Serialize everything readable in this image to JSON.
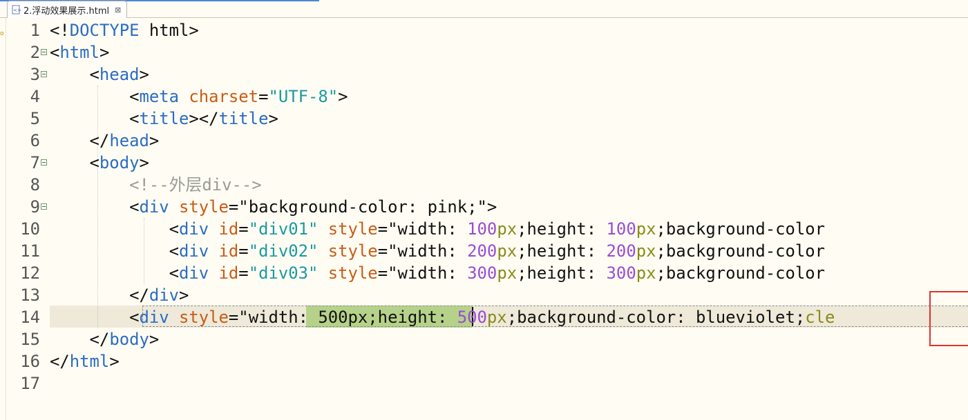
{
  "tab": {
    "title": "2.浮动效果展示.html",
    "close_glyph": "⊠",
    "icon": "html-file-icon"
  },
  "left_marker": "o",
  "colors": {
    "tag": "#2a6cc4",
    "attr": "#c85c16",
    "value": "#1a9aa0",
    "number": "#9a4bd6",
    "unit": "#8a8a1a",
    "comment": "#9a9a9a",
    "selection": "#b6d28a",
    "highlight_box": "#e0312b"
  },
  "editor": {
    "current_line": 14,
    "lines": [
      {
        "n": "1",
        "fold": false,
        "tokens": [
          {
            "t": "<!",
            "c": "br"
          },
          {
            "t": "DOCTYPE",
            "c": "tag"
          },
          {
            "t": " html",
            "c": "txt"
          },
          {
            "t": ">",
            "c": "br"
          }
        ]
      },
      {
        "n": "2",
        "fold": true,
        "tokens": [
          {
            "t": "<",
            "c": "br"
          },
          {
            "t": "html",
            "c": "tag"
          },
          {
            "t": ">",
            "c": "br"
          }
        ]
      },
      {
        "n": "3",
        "fold": true,
        "tokens": [
          {
            "t": "    <",
            "c": "br"
          },
          {
            "t": "head",
            "c": "tag"
          },
          {
            "t": ">",
            "c": "br"
          }
        ]
      },
      {
        "n": "4",
        "fold": false,
        "tokens": [
          {
            "t": "        <",
            "c": "br"
          },
          {
            "t": "meta",
            "c": "tag"
          },
          {
            "t": " charset",
            "c": "attr"
          },
          {
            "t": "=",
            "c": "br"
          },
          {
            "t": "\"UTF-8\"",
            "c": "val"
          },
          {
            "t": ">",
            "c": "br"
          }
        ]
      },
      {
        "n": "5",
        "fold": false,
        "tokens": [
          {
            "t": "        <",
            "c": "br"
          },
          {
            "t": "title",
            "c": "tag"
          },
          {
            "t": "></",
            "c": "br"
          },
          {
            "t": "title",
            "c": "tag"
          },
          {
            "t": ">",
            "c": "br"
          }
        ]
      },
      {
        "n": "6",
        "fold": false,
        "tokens": [
          {
            "t": "    </",
            "c": "br"
          },
          {
            "t": "head",
            "c": "tag"
          },
          {
            "t": ">",
            "c": "br"
          }
        ]
      },
      {
        "n": "7",
        "fold": true,
        "tokens": [
          {
            "t": "    <",
            "c": "br"
          },
          {
            "t": "body",
            "c": "tag"
          },
          {
            "t": ">",
            "c": "br"
          }
        ]
      },
      {
        "n": "8",
        "fold": false,
        "tokens": [
          {
            "t": "        <!--外层div-->",
            "c": "com"
          }
        ]
      },
      {
        "n": "9",
        "fold": true,
        "tokens": [
          {
            "t": "        <",
            "c": "br"
          },
          {
            "t": "div",
            "c": "tag"
          },
          {
            "t": " style",
            "c": "attr"
          },
          {
            "t": "=\"",
            "c": "br"
          },
          {
            "t": "background-color: pink;",
            "c": "txt"
          },
          {
            "t": "\">",
            "c": "br"
          }
        ]
      },
      {
        "n": "10",
        "fold": false,
        "tokens": [
          {
            "t": "            <",
            "c": "br"
          },
          {
            "t": "div",
            "c": "tag"
          },
          {
            "t": " id",
            "c": "attr"
          },
          {
            "t": "=",
            "c": "br"
          },
          {
            "t": "\"div01\"",
            "c": "val"
          },
          {
            "t": " style",
            "c": "attr"
          },
          {
            "t": "=\"",
            "c": "br"
          },
          {
            "t": "width: ",
            "c": "txt"
          },
          {
            "t": "100",
            "c": "num"
          },
          {
            "t": "px",
            "c": "px"
          },
          {
            "t": ";height: ",
            "c": "txt"
          },
          {
            "t": "100",
            "c": "num"
          },
          {
            "t": "px",
            "c": "px"
          },
          {
            "t": ";background-color",
            "c": "txt"
          }
        ]
      },
      {
        "n": "11",
        "fold": false,
        "tokens": [
          {
            "t": "            <",
            "c": "br"
          },
          {
            "t": "div",
            "c": "tag"
          },
          {
            "t": " id",
            "c": "attr"
          },
          {
            "t": "=",
            "c": "br"
          },
          {
            "t": "\"div02\"",
            "c": "val"
          },
          {
            "t": " style",
            "c": "attr"
          },
          {
            "t": "=\"",
            "c": "br"
          },
          {
            "t": "width: ",
            "c": "txt"
          },
          {
            "t": "200",
            "c": "num"
          },
          {
            "t": "px",
            "c": "px"
          },
          {
            "t": ";height: ",
            "c": "txt"
          },
          {
            "t": "200",
            "c": "num"
          },
          {
            "t": "px",
            "c": "px"
          },
          {
            "t": ";background-color",
            "c": "txt"
          }
        ]
      },
      {
        "n": "12",
        "fold": false,
        "tokens": [
          {
            "t": "            <",
            "c": "br"
          },
          {
            "t": "div",
            "c": "tag"
          },
          {
            "t": " id",
            "c": "attr"
          },
          {
            "t": "=",
            "c": "br"
          },
          {
            "t": "\"div03\"",
            "c": "val"
          },
          {
            "t": " style",
            "c": "attr"
          },
          {
            "t": "=\"",
            "c": "br"
          },
          {
            "t": "width: ",
            "c": "txt"
          },
          {
            "t": "300",
            "c": "num"
          },
          {
            "t": "px",
            "c": "px"
          },
          {
            "t": ";height: ",
            "c": "txt"
          },
          {
            "t": "300",
            "c": "num"
          },
          {
            "t": "px",
            "c": "px"
          },
          {
            "t": ";background-color",
            "c": "txt"
          }
        ]
      },
      {
        "n": "13",
        "fold": false,
        "tokens": [
          {
            "t": "        </",
            "c": "br"
          },
          {
            "t": "div",
            "c": "tag"
          },
          {
            "t": ">",
            "c": "br"
          }
        ]
      },
      {
        "n": "14",
        "fold": false,
        "tokens": [
          {
            "t": "        <",
            "c": "br"
          },
          {
            "t": "div",
            "c": "tag"
          },
          {
            "t": " style",
            "c": "attr"
          },
          {
            "t": "=\"",
            "c": "br"
          },
          {
            "t": "width: 500px;height: ",
            "c": "txt"
          },
          {
            "t": "500",
            "c": "num"
          },
          {
            "t": "px",
            "c": "px"
          },
          {
            "t": ";background-color: blueviolet;",
            "c": "txt"
          },
          {
            "t": "cle",
            "c": "px"
          }
        ]
      },
      {
        "n": "15",
        "fold": false,
        "tokens": [
          {
            "t": "    </",
            "c": "br"
          },
          {
            "t": "body",
            "c": "tag"
          },
          {
            "t": ">",
            "c": "br"
          }
        ]
      },
      {
        "n": "16",
        "fold": false,
        "tokens": [
          {
            "t": "</",
            "c": "br"
          },
          {
            "t": "html",
            "c": "tag"
          },
          {
            "t": ">",
            "c": "br"
          }
        ]
      },
      {
        "n": "17",
        "fold": false,
        "tokens": []
      }
    ]
  }
}
